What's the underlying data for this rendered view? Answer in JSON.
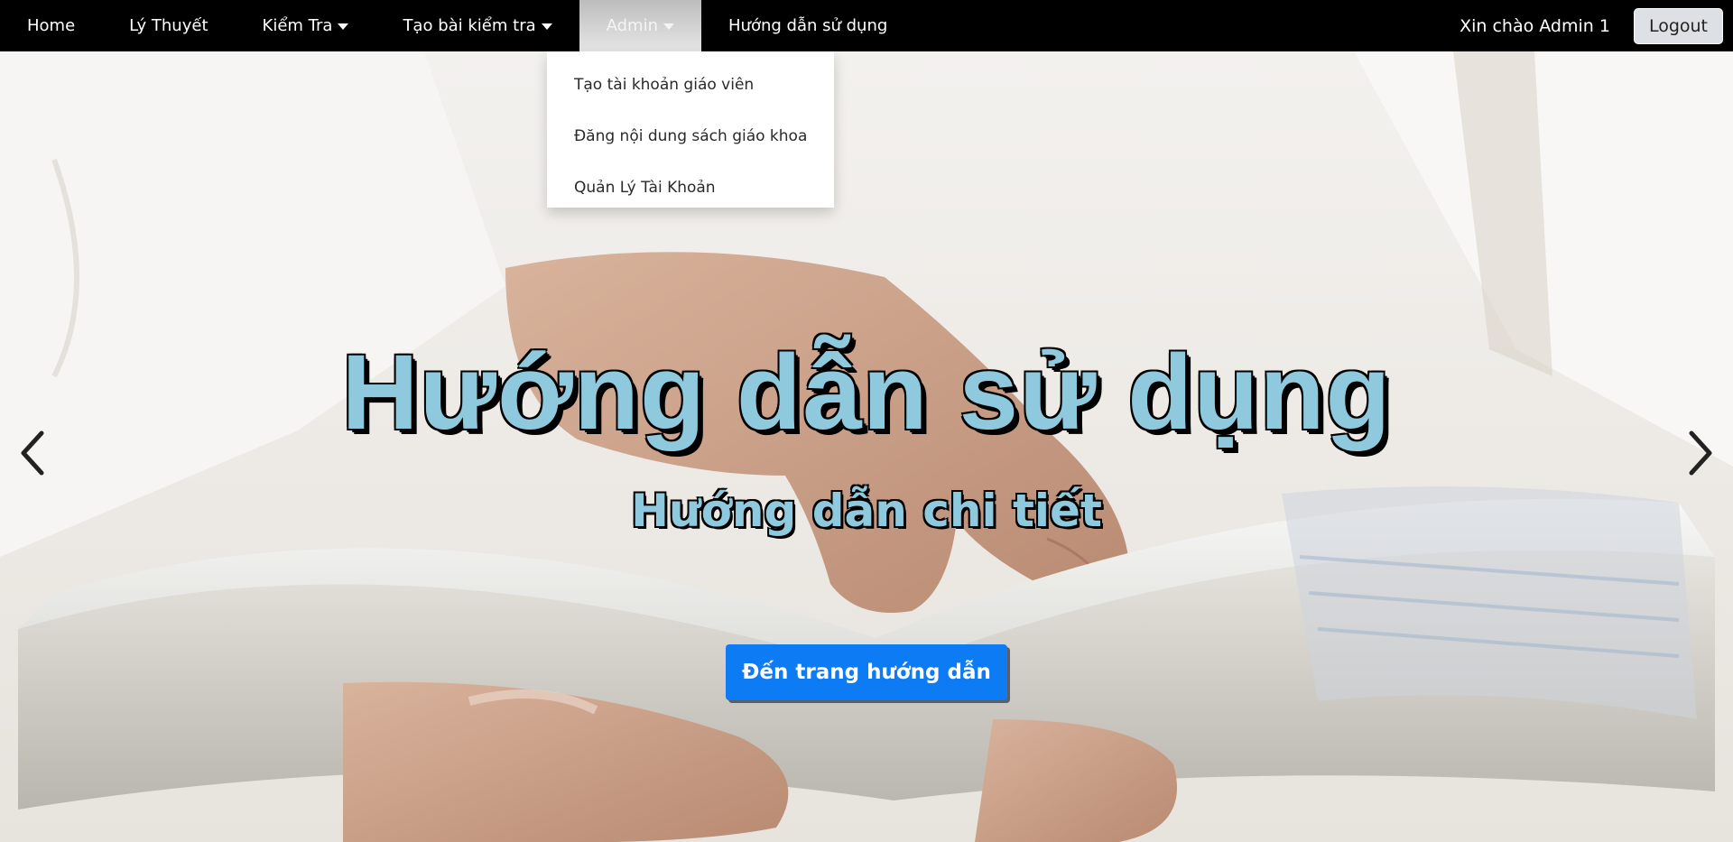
{
  "nav": {
    "items": [
      {
        "label": "Home",
        "has_caret": false
      },
      {
        "label": "Lý Thuyết",
        "has_caret": false
      },
      {
        "label": "Kiểm Tra",
        "has_caret": true
      },
      {
        "label": "Tạo bài kiểm tra",
        "has_caret": true
      },
      {
        "label": "Admin",
        "has_caret": true,
        "active": true
      },
      {
        "label": "Hướng dẫn sử dụng",
        "has_caret": false
      }
    ],
    "greeting": "Xin chào Admin 1",
    "logout_label": "Logout"
  },
  "admin_dropdown": {
    "items": [
      "Tạo tài khoản giáo viên",
      "Đăng nội dung sách giáo khoa",
      "Quản Lý Tài Khoản"
    ]
  },
  "hero": {
    "title": "Hướng dẫn sử dụng",
    "subtitle": "Hướng dẫn chi tiết",
    "cta_label": "Đến trang hướng dẫn",
    "prev_icon": "chevron-left-icon",
    "next_icon": "chevron-right-icon"
  },
  "colors": {
    "navbar_bg": "#000000",
    "title_fill": "#8ec9dd",
    "cta_bg": "#0d7cf4"
  }
}
